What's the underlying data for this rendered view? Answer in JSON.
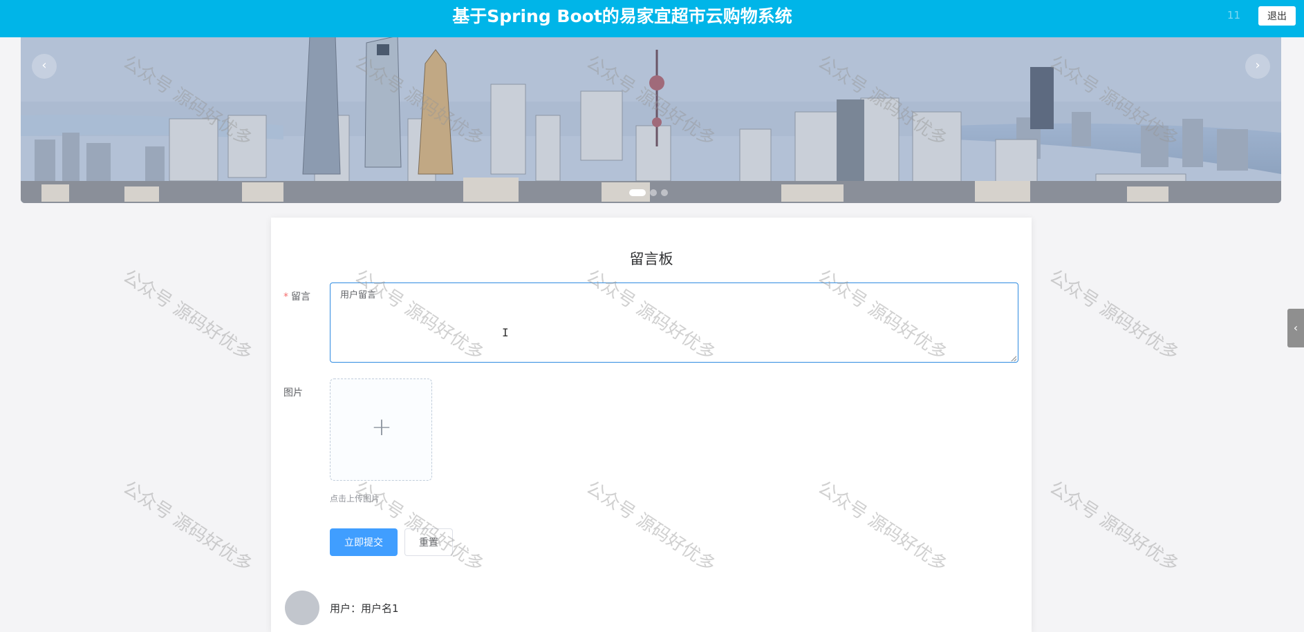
{
  "header": {
    "title": "基于Spring Boot的易家宜超市云购物系统",
    "user": "11",
    "logout_label": "退出",
    "bg_color": "#00b5e8"
  },
  "banner": {
    "prev_icon": "‹",
    "next_icon": "›",
    "slide_count": 3,
    "active_slide": 1
  },
  "board": {
    "title": "留言板",
    "message_label": "留言",
    "required_mark": "*",
    "message_value": "用户留言",
    "image_label": "图片",
    "upload_plus": "+",
    "upload_tip": "点击上传图片",
    "submit_label": "立即提交",
    "reset_label": "重置",
    "cursor_glyph": "I"
  },
  "comments": [
    {
      "user": "用户：用户名1"
    }
  ],
  "side_tab_icon": "‹",
  "watermark_text": "公众号 源码好优多",
  "colors": {
    "primary": "#409eff",
    "required": "#f56c6c"
  }
}
